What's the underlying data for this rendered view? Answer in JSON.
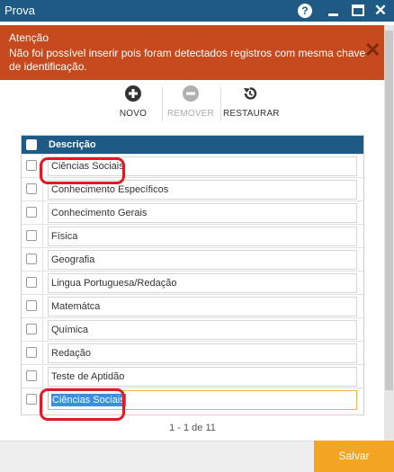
{
  "window": {
    "title": "Prova",
    "colors": {
      "titlebar": "#1f5a84",
      "alert": "#c64a1e",
      "save": "#f2a623"
    },
    "controls": {
      "help": "?"
    }
  },
  "alert": {
    "title": "Atenção",
    "message": "Não foi possível inserir pois foram detectados registros com mesma chave de identificação.",
    "close_icon": "close-icon"
  },
  "toolbar": {
    "novo": "NOVO",
    "remover": "REMOVER",
    "restaurar": "RESTAURAR"
  },
  "grid": {
    "header": "Descrição",
    "rows": [
      "Ciências Sociais",
      "Conhecimento Específicos",
      "Conhecimento Gerais",
      "Física",
      "Geografia",
      "Lingua Portuguesa/Redação",
      "Matemátca",
      "Química",
      "Redação",
      "Teste de Aptidão",
      "Ciências Sociais"
    ]
  },
  "pager": "1 - 1 de 11",
  "footer": {
    "save": "Salvar"
  }
}
